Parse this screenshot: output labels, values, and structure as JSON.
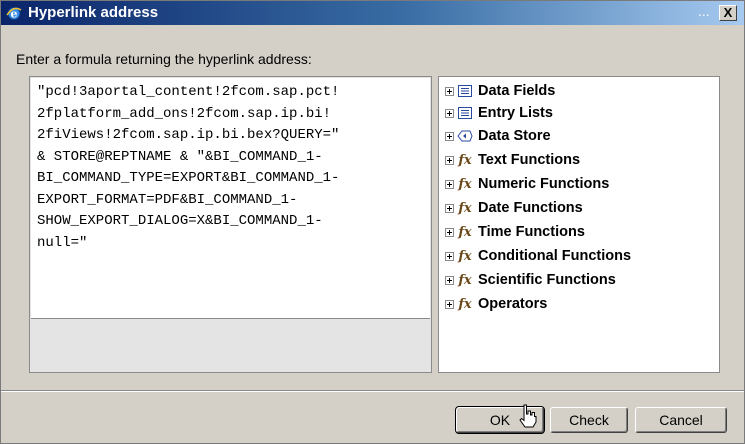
{
  "window": {
    "title": "Hyperlink address",
    "ellipsis": "...",
    "close_label": "X"
  },
  "prompt": "Enter a formula returning the hyperlink address:",
  "formula": "\"pcd!3aportal_content!2fcom.sap.pct!\n2fplatform_add_ons!2fcom.sap.ip.bi!\n2fiViews!2fcom.sap.ip.bi.bex?QUERY=\"\n& STORE@REPTNAME & \"&BI_COMMAND_1-\nBI_COMMAND_TYPE=EXPORT&BI_COMMAND_1-\nEXPORT_FORMAT=PDF&BI_COMMAND_1-\nSHOW_EXPORT_DIALOG=X&BI_COMMAND_1-\nnull=\"",
  "tree": {
    "items": [
      {
        "label": "Data Fields",
        "icon": "list-icon"
      },
      {
        "label": "Entry Lists",
        "icon": "list-icon"
      },
      {
        "label": "Data Store",
        "icon": "data-store-icon"
      },
      {
        "label": "Text Functions",
        "icon": "function-icon"
      },
      {
        "label": "Numeric Functions",
        "icon": "function-icon"
      },
      {
        "label": "Date Functions",
        "icon": "function-icon"
      },
      {
        "label": "Time Functions",
        "icon": "function-icon"
      },
      {
        "label": "Conditional Functions",
        "icon": "function-icon"
      },
      {
        "label": "Scientific Functions",
        "icon": "function-icon"
      },
      {
        "label": "Operators",
        "icon": "function-icon"
      }
    ],
    "fx_glyph": "fx"
  },
  "buttons": {
    "ok": "OK",
    "check": "Check",
    "cancel": "Cancel"
  }
}
